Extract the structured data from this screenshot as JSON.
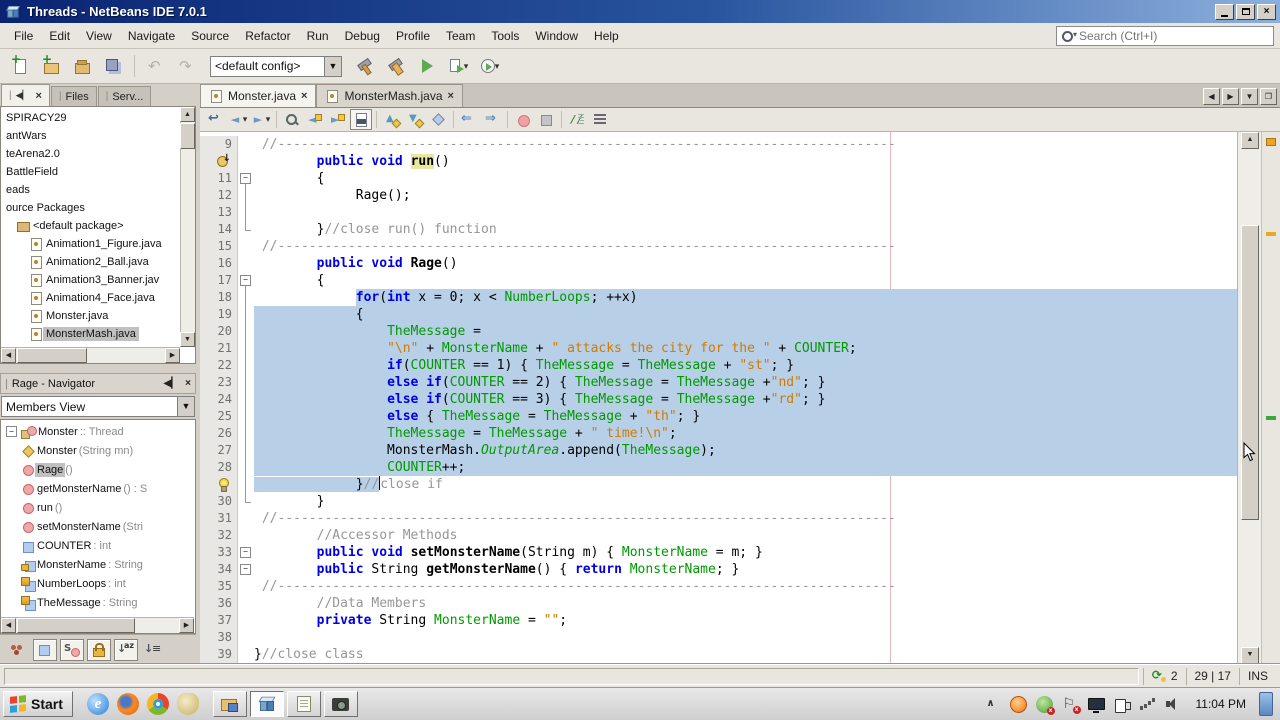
{
  "colors": {
    "selection": "#b8cfe8",
    "keyword": "#0000e6",
    "comment": "#969696",
    "string": "#ce7b00",
    "field": "#009900",
    "occurrence": "#e9e7a1",
    "titlebar": "#0a2472"
  },
  "window": {
    "title": "Threads - NetBeans IDE 7.0.1"
  },
  "menu": [
    "File",
    "Edit",
    "View",
    "Navigate",
    "Source",
    "Refactor",
    "Run",
    "Debug",
    "Profile",
    "Team",
    "Tools",
    "Window",
    "Help"
  ],
  "search": {
    "placeholder": "Search (Ctrl+I)"
  },
  "main_toolbar": {
    "config": "<default config>",
    "buttons": [
      {
        "name": "new-file"
      },
      {
        "name": "new-project"
      },
      {
        "name": "open-project"
      },
      {
        "name": "save-all"
      },
      {
        "sep": true
      },
      {
        "name": "undo"
      },
      {
        "name": "redo"
      },
      {
        "combo": true
      },
      {
        "name": "build"
      },
      {
        "name": "clean-build"
      },
      {
        "name": "run"
      },
      {
        "name": "debug",
        "dd": true
      },
      {
        "name": "profile",
        "dd": true
      }
    ]
  },
  "left_tabs": {
    "files": "Files",
    "services": "Serv..."
  },
  "projects_tree": [
    {
      "label": "SPIRACY29",
      "indent": 0
    },
    {
      "label": "antWars",
      "indent": 0
    },
    {
      "label": "teArena2.0",
      "indent": 0
    },
    {
      "label": "BattleField",
      "indent": 0
    },
    {
      "label": "eads",
      "indent": 0
    },
    {
      "label": "ource Packages",
      "indent": 0
    },
    {
      "label": "<default package>",
      "indent": 1,
      "icon": "package"
    },
    {
      "label": "Animation1_Figure.java",
      "indent": 2,
      "icon": "java-class"
    },
    {
      "label": "Animation2_Ball.java",
      "indent": 2,
      "icon": "java-class"
    },
    {
      "label": "Animation3_Banner.jav",
      "indent": 2,
      "icon": "java-class"
    },
    {
      "label": "Animation4_Face.java",
      "indent": 2,
      "icon": "java-class"
    },
    {
      "label": "Monster.java",
      "indent": 2,
      "icon": "java-class"
    },
    {
      "label": "MonsterMash.java",
      "indent": 2,
      "icon": "java-class",
      "selected": true
    }
  ],
  "navigator": {
    "title": "Rage - Navigator",
    "view_mode": "Members View",
    "root": {
      "name": "Monster",
      "type": " :: Thread"
    },
    "members": [
      {
        "icon": "constructor",
        "name": "Monster",
        "detail": "(String mn)"
      },
      {
        "icon": "method",
        "name": "Rage",
        "detail": "()",
        "selected": true
      },
      {
        "icon": "method",
        "name": "getMonsterName",
        "detail": "() : S"
      },
      {
        "icon": "method",
        "name": "run",
        "detail": "()"
      },
      {
        "icon": "method",
        "name": "setMonsterName",
        "detail": "(Stri"
      },
      {
        "icon": "field",
        "name": "COUNTER",
        "detail": " : int"
      },
      {
        "icon": "field-private",
        "name": "MonsterName",
        "detail": " : String"
      },
      {
        "icon": "field-static",
        "name": "NumberLoops",
        "detail": " : int"
      },
      {
        "icon": "field-static",
        "name": "TheMessage",
        "detail": " : String"
      }
    ],
    "filters": [
      {
        "name": "inherited",
        "pressed": false
      },
      {
        "name": "fields-filter",
        "pressed": true
      },
      {
        "name": "static-filter",
        "pressed": true
      },
      {
        "name": "nonpublic",
        "pressed": true
      },
      {
        "name": "sort-alpha",
        "pressed": true
      },
      {
        "name": "sort-source",
        "pressed": false
      }
    ]
  },
  "editor": {
    "tabs": [
      {
        "label": "Monster.java",
        "active": true
      },
      {
        "label": "MonsterMash.java",
        "active": false
      }
    ],
    "toolbar": [
      {
        "name": "last-edit"
      },
      {
        "name": "back",
        "dd": true
      },
      {
        "name": "forward",
        "dd": true
      },
      {
        "sep": true
      },
      {
        "name": "find"
      },
      {
        "name": "find-prev"
      },
      {
        "name": "find-next"
      },
      {
        "name": "highlight",
        "pressed": true
      },
      {
        "sep": true
      },
      {
        "name": "prev-bookmark"
      },
      {
        "name": "next-bookmark"
      },
      {
        "name": "toggle-bookmark"
      },
      {
        "sep": true
      },
      {
        "name": "shift-left"
      },
      {
        "name": "shift-right"
      },
      {
        "sep": true
      },
      {
        "name": "breakpoint"
      },
      {
        "name": "stop"
      },
      {
        "sep": true
      },
      {
        "name": "comment"
      },
      {
        "name": "uncomment"
      }
    ],
    "lines": [
      {
        "n": 9,
        "tok": [
          [
            "c",
            " //-------------------------------------------------------------------------------"
          ]
        ]
      },
      {
        "n": 10,
        "g": "override",
        "tok": [
          [
            "p",
            "        "
          ],
          [
            "k",
            "public"
          ],
          [
            "p",
            " "
          ],
          [
            "k",
            "void"
          ],
          [
            "p",
            " "
          ],
          [
            "hl",
            "run"
          ],
          [
            "p",
            "()"
          ]
        ]
      },
      {
        "n": 11,
        "fold": "box",
        "tok": [
          [
            "p",
            "        {"
          ]
        ]
      },
      {
        "n": 12,
        "fold": "line",
        "tok": [
          [
            "p",
            "             Rage();"
          ]
        ]
      },
      {
        "n": 13,
        "fold": "line",
        "tok": []
      },
      {
        "n": 14,
        "fold": "end",
        "tok": [
          [
            "p",
            "        }"
          ],
          [
            "c",
            "//close run() function"
          ]
        ]
      },
      {
        "n": 15,
        "tok": [
          [
            "c",
            " //-------------------------------------------------------------------------------"
          ]
        ]
      },
      {
        "n": 16,
        "tok": [
          [
            "p",
            "        "
          ],
          [
            "k",
            "public"
          ],
          [
            "p",
            " "
          ],
          [
            "k",
            "void"
          ],
          [
            "p",
            " "
          ],
          [
            "m",
            "Rage"
          ],
          [
            "p",
            "()"
          ]
        ]
      },
      {
        "n": 17,
        "fold": "box",
        "tok": [
          [
            "p",
            "        {"
          ]
        ]
      },
      {
        "n": 18,
        "fold": "line",
        "sel": "text",
        "pre": "             ",
        "tok": [
          [
            "k",
            "for"
          ],
          [
            "p",
            "("
          ],
          [
            "k",
            "int"
          ],
          [
            "p",
            " x = 0; x < "
          ],
          [
            "f",
            "NumberLoops"
          ],
          [
            "p",
            "; ++x)"
          ]
        ]
      },
      {
        "n": 19,
        "fold": "line",
        "sel": "full",
        "tok": [
          [
            "p",
            "             {"
          ]
        ]
      },
      {
        "n": 20,
        "fold": "line",
        "sel": "full",
        "tok": [
          [
            "p",
            "                 "
          ],
          [
            "f",
            "TheMessage"
          ],
          [
            "p",
            " ="
          ]
        ]
      },
      {
        "n": 21,
        "fold": "line",
        "sel": "full",
        "tok": [
          [
            "p",
            "                 "
          ],
          [
            "s",
            "\"\\n\""
          ],
          [
            "p",
            " + "
          ],
          [
            "f",
            "MonsterName"
          ],
          [
            "p",
            " + "
          ],
          [
            "s",
            "\" attacks the city for the \""
          ],
          [
            "p",
            " + "
          ],
          [
            "f",
            "COUNTER"
          ],
          [
            "p",
            ";"
          ]
        ]
      },
      {
        "n": 22,
        "fold": "line",
        "sel": "full",
        "tok": [
          [
            "p",
            "                 "
          ],
          [
            "k",
            "if"
          ],
          [
            "p",
            "("
          ],
          [
            "f",
            "COUNTER"
          ],
          [
            "p",
            " == 1) { "
          ],
          [
            "f",
            "TheMessage"
          ],
          [
            "p",
            " = "
          ],
          [
            "f",
            "TheMessage"
          ],
          [
            "p",
            " + "
          ],
          [
            "s",
            "\"st\""
          ],
          [
            "p",
            "; }"
          ]
        ]
      },
      {
        "n": 23,
        "fold": "line",
        "sel": "full",
        "tok": [
          [
            "p",
            "                 "
          ],
          [
            "k",
            "else"
          ],
          [
            "p",
            " "
          ],
          [
            "k",
            "if"
          ],
          [
            "p",
            "("
          ],
          [
            "f",
            "COUNTER"
          ],
          [
            "p",
            " == 2) { "
          ],
          [
            "f",
            "TheMessage"
          ],
          [
            "p",
            " = "
          ],
          [
            "f",
            "TheMessage"
          ],
          [
            "p",
            " +"
          ],
          [
            "s",
            "\"nd\""
          ],
          [
            "p",
            "; }"
          ]
        ]
      },
      {
        "n": 24,
        "fold": "line",
        "sel": "full",
        "tok": [
          [
            "p",
            "                 "
          ],
          [
            "k",
            "else"
          ],
          [
            "p",
            " "
          ],
          [
            "k",
            "if"
          ],
          [
            "p",
            "("
          ],
          [
            "f",
            "COUNTER"
          ],
          [
            "p",
            " == 3) { "
          ],
          [
            "f",
            "TheMessage"
          ],
          [
            "p",
            " = "
          ],
          [
            "f",
            "TheMessage"
          ],
          [
            "p",
            " +"
          ],
          [
            "s",
            "\"rd\""
          ],
          [
            "p",
            "; }"
          ]
        ]
      },
      {
        "n": 25,
        "fold": "line",
        "sel": "full",
        "tok": [
          [
            "p",
            "                 "
          ],
          [
            "k",
            "else"
          ],
          [
            "p",
            " { "
          ],
          [
            "f",
            "TheMessage"
          ],
          [
            "p",
            " = "
          ],
          [
            "f",
            "TheMessage"
          ],
          [
            "p",
            " + "
          ],
          [
            "s",
            "\"th\""
          ],
          [
            "p",
            "; }"
          ]
        ]
      },
      {
        "n": 26,
        "fold": "line",
        "sel": "full",
        "tok": [
          [
            "p",
            "                 "
          ],
          [
            "f",
            "TheMessage"
          ],
          [
            "p",
            " = "
          ],
          [
            "f",
            "TheMessage"
          ],
          [
            "p",
            " + "
          ],
          [
            "s",
            "\" time!\\n\""
          ],
          [
            "p",
            ";"
          ]
        ]
      },
      {
        "n": 27,
        "fold": "line",
        "sel": "full",
        "tok": [
          [
            "p",
            "                 MonsterMash."
          ],
          [
            "sf",
            "OutputArea"
          ],
          [
            "p",
            ".append("
          ],
          [
            "f",
            "TheMessage"
          ],
          [
            "p",
            ");"
          ]
        ]
      },
      {
        "n": 28,
        "fold": "line",
        "sel": "full",
        "tok": [
          [
            "p",
            "                 "
          ],
          [
            "f",
            "COUNTER"
          ],
          [
            "p",
            "++;"
          ]
        ]
      },
      {
        "n": 29,
        "g": "bulb",
        "fold": "line",
        "sel": "head",
        "head": [
          [
            "p",
            "             }"
          ],
          [
            "c",
            "//"
          ]
        ],
        "caret": true,
        "tok": [
          [
            "c",
            "close if"
          ]
        ]
      },
      {
        "n": 30,
        "fold": "end",
        "tok": [
          [
            "p",
            "        }"
          ]
        ]
      },
      {
        "n": 31,
        "tok": [
          [
            "c",
            " //-------------------------------------------------------------------------------"
          ]
        ]
      },
      {
        "n": 32,
        "tok": [
          [
            "c",
            "        //Accessor Methods"
          ]
        ]
      },
      {
        "n": 33,
        "fold": "boxonly",
        "tok": [
          [
            "p",
            "        "
          ],
          [
            "k",
            "public"
          ],
          [
            "p",
            " "
          ],
          [
            "k",
            "void"
          ],
          [
            "p",
            " "
          ],
          [
            "m",
            "setMonsterName"
          ],
          [
            "p",
            "(String m) { "
          ],
          [
            "f",
            "MonsterName"
          ],
          [
            "p",
            " = m; }"
          ]
        ]
      },
      {
        "n": 34,
        "fold": "boxonly",
        "tok": [
          [
            "p",
            "        "
          ],
          [
            "k",
            "public"
          ],
          [
            "p",
            " String "
          ],
          [
            "m",
            "getMonsterName"
          ],
          [
            "p",
            "() { "
          ],
          [
            "k",
            "return"
          ],
          [
            "p",
            " "
          ],
          [
            "f",
            "MonsterName"
          ],
          [
            "p",
            "; }"
          ]
        ]
      },
      {
        "n": 35,
        "tok": [
          [
            "c",
            " //-------------------------------------------------------------------------------"
          ]
        ]
      },
      {
        "n": 36,
        "tok": [
          [
            "c",
            "        //Data Members"
          ]
        ]
      },
      {
        "n": 37,
        "tok": [
          [
            "p",
            "        "
          ],
          [
            "k",
            "private"
          ],
          [
            "p",
            " String "
          ],
          [
            "f",
            "MonsterName"
          ],
          [
            "p",
            " = "
          ],
          [
            "s",
            "\"\""
          ],
          [
            "p",
            ";"
          ]
        ]
      },
      {
        "n": 38,
        "tok": []
      },
      {
        "n": 39,
        "tok": [
          [
            "p",
            "}"
          ],
          [
            "c",
            "//close class"
          ]
        ]
      }
    ]
  },
  "status_bar": {
    "updates": "2",
    "caret": "29 | 17",
    "mode": "INS"
  },
  "taskbar": {
    "start_label": "Start",
    "clock": "11:04 PM",
    "quick_launch": [
      "ie",
      "firefox",
      "chrome",
      "messenger"
    ],
    "apps": [
      {
        "icon": "folder",
        "active": false
      },
      {
        "icon": "netbeans",
        "active": true
      },
      {
        "icon": "notepad",
        "active": false
      },
      {
        "icon": "camera",
        "active": false
      }
    ],
    "tray": [
      "expand",
      "media",
      "netx",
      "flag",
      "display",
      "power",
      "signal",
      "volume"
    ]
  }
}
